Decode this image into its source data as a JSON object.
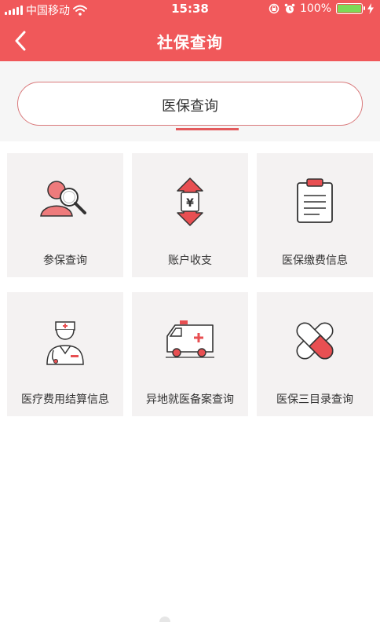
{
  "status_bar": {
    "carrier": "中国移动",
    "time": "15:38",
    "battery": "100%",
    "battery_level": 1.0,
    "icons": [
      "signal-icon",
      "wifi-icon",
      "screen-lock-icon",
      "alarm-icon",
      "battery-icon",
      "charging-icon"
    ]
  },
  "header": {
    "title": "社保查询",
    "back_icon": "chevron-left-icon"
  },
  "segment": {
    "label": "医保查询"
  },
  "tiles": [
    {
      "label": "参保查询",
      "icon": "user-search-icon"
    },
    {
      "label": "账户收支",
      "icon": "account-flow-icon"
    },
    {
      "label": "医保缴费信息",
      "icon": "clipboard-icon"
    },
    {
      "label": "医疗费用结算信息",
      "icon": "doctor-icon"
    },
    {
      "label": "异地就医备案查询",
      "icon": "ambulance-icon"
    },
    {
      "label": "医保三目录查询",
      "icon": "pill-capsule-icon"
    }
  ],
  "colors": {
    "brand": "#f0585a",
    "accent": "#e35a5c",
    "tile_bg": "#f4f2f2",
    "page_bg": "#f6f6f6"
  }
}
